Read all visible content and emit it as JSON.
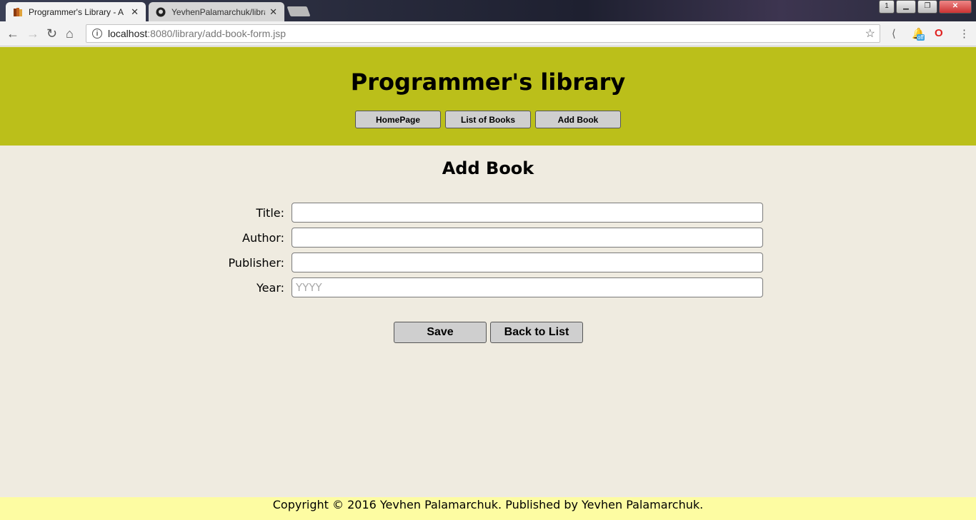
{
  "browser": {
    "tabs": [
      {
        "title": "Programmer's Library - A",
        "active": true
      },
      {
        "title": "YevhenPalamarchuk/libra",
        "active": false
      }
    ],
    "url_host": "localhost",
    "url_path": ":8080/library/add-book-form.jsp",
    "window_badge": "1",
    "extension_badge": "off"
  },
  "header": {
    "title": "Programmer's library",
    "nav": [
      "HomePage",
      "List of Books",
      "Add Book"
    ]
  },
  "form": {
    "title": "Add Book",
    "fields": [
      {
        "label": "Title:",
        "value": "",
        "placeholder": ""
      },
      {
        "label": "Author:",
        "value": "",
        "placeholder": ""
      },
      {
        "label": "Publisher:",
        "value": "",
        "placeholder": ""
      },
      {
        "label": "Year:",
        "value": "",
        "placeholder": "YYYY"
      }
    ],
    "save_label": "Save",
    "back_label": "Back to List"
  },
  "footer": {
    "text": "Copyright © 2016 Yevhen Palamarchuk. Published by Yevhen Palamarchuk."
  },
  "colors": {
    "header_bg": "#bbbf1a",
    "page_bg": "#efebe0",
    "footer_bg": "#fdfca2"
  }
}
